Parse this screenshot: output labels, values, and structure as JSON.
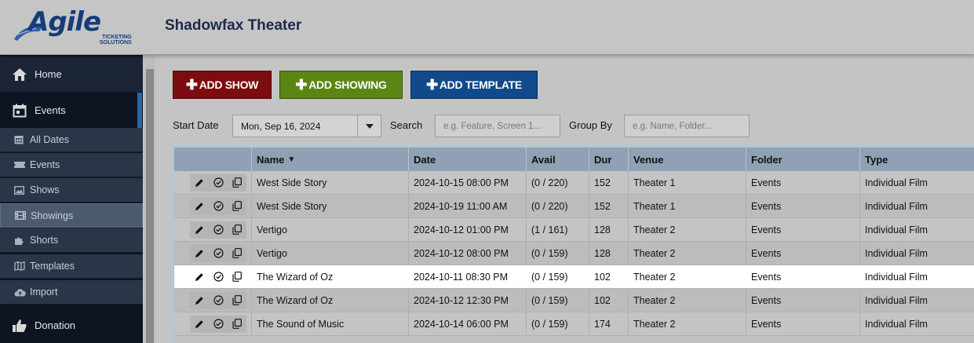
{
  "header": {
    "logo_word": "Agile",
    "logo_sub_line1": "TICKETING",
    "logo_sub_line2": "SOLUTIONS",
    "title": "Shadowfax Theater"
  },
  "sidebar": {
    "home": "Home",
    "events": "Events",
    "items": [
      {
        "label": "All Dates",
        "icon": "calendar-grid-icon"
      },
      {
        "label": "Events",
        "icon": "ticket-icon"
      },
      {
        "label": "Shows",
        "icon": "image-icon"
      },
      {
        "label": "Showings",
        "icon": "film-icon"
      },
      {
        "label": "Shorts",
        "icon": "puzzle-icon"
      },
      {
        "label": "Templates",
        "icon": "map-icon"
      },
      {
        "label": "Import",
        "icon": "cloud-upload-icon"
      }
    ],
    "donation": "Donation"
  },
  "toolbar": {
    "add_show": "ADD SHOW",
    "add_showing": "ADD SHOWING",
    "add_template": "ADD TEMPLATE"
  },
  "filters": {
    "start_date_label": "Start Date",
    "start_date_value": "Mon, Sep 16, 2024",
    "search_label": "Search",
    "search_placeholder": "e.g. Feature, Screen 1...",
    "group_by_label": "Group By",
    "group_by_placeholder": "e.g. Name, Folder..."
  },
  "table": {
    "headers": [
      "",
      "Name",
      "Date",
      "Avail",
      "Dur",
      "Venue",
      "Folder",
      "Type"
    ],
    "rows": [
      {
        "name": "West Side Story",
        "date": "2024-10-15 08:00 PM",
        "avail": "(0 / 220)",
        "dur": "152",
        "venue": "Theater 1",
        "folder": "Events",
        "type": "Individual Film"
      },
      {
        "name": "West Side Story",
        "date": "2024-10-19 11:00 AM",
        "avail": "(0 / 220)",
        "dur": "152",
        "venue": "Theater 1",
        "folder": "Events",
        "type": "Individual Film"
      },
      {
        "name": "Vertigo",
        "date": "2024-10-12 01:00 PM",
        "avail": "(1 / 161)",
        "dur": "128",
        "venue": "Theater 2",
        "folder": "Events",
        "type": "Individual Film"
      },
      {
        "name": "Vertigo",
        "date": "2024-10-12 08:00 PM",
        "avail": "(0 / 159)",
        "dur": "128",
        "venue": "Theater 2",
        "folder": "Events",
        "type": "Individual Film"
      },
      {
        "name": "The Wizard of Oz",
        "date": "2024-10-11 08:30 PM",
        "avail": "(0 / 159)",
        "dur": "102",
        "venue": "Theater 2",
        "folder": "Events",
        "type": "Individual Film"
      },
      {
        "name": "The Wizard of Oz",
        "date": "2024-10-12 12:30 PM",
        "avail": "(0 / 159)",
        "dur": "102",
        "venue": "Theater 2",
        "folder": "Events",
        "type": "Individual Film"
      },
      {
        "name": "The Sound of Music",
        "date": "2024-10-14 06:00 PM",
        "avail": "(0 / 159)",
        "dur": "174",
        "venue": "Theater 2",
        "folder": "Events",
        "type": "Individual Film"
      }
    ]
  },
  "colors": {
    "add_show": "#7d0c10",
    "add_showing": "#5b8614",
    "add_template": "#114a8a",
    "sidebar_bg": "#0d1523",
    "accent": "#2d64a6"
  }
}
